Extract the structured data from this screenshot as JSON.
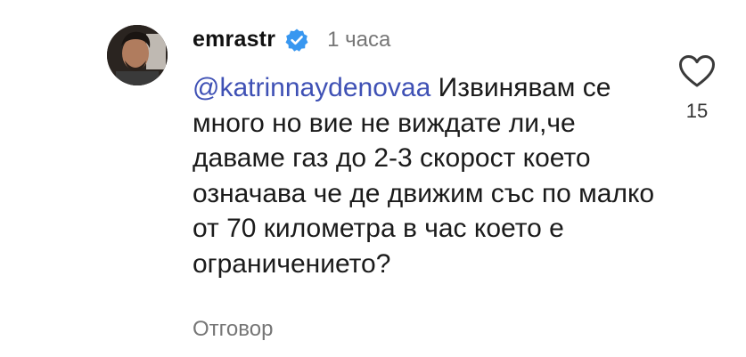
{
  "comment": {
    "username": "emrastr",
    "verified_icon": "verified-badge-icon",
    "time": "1 часа",
    "mention": "@katrinnaydenovaa",
    "text": " Извинявам се много но вие не виждате ли,че даваме газ до 2-3 скорост което означава че де движим със по малко от 70 километра в час което е ограничението?",
    "like_icon": "heart-outline-icon",
    "like_count": "15",
    "reply_label": "Отговор"
  },
  "colors": {
    "verified": "#3897f0",
    "mention": "#3f51b5",
    "muted": "#767676"
  }
}
